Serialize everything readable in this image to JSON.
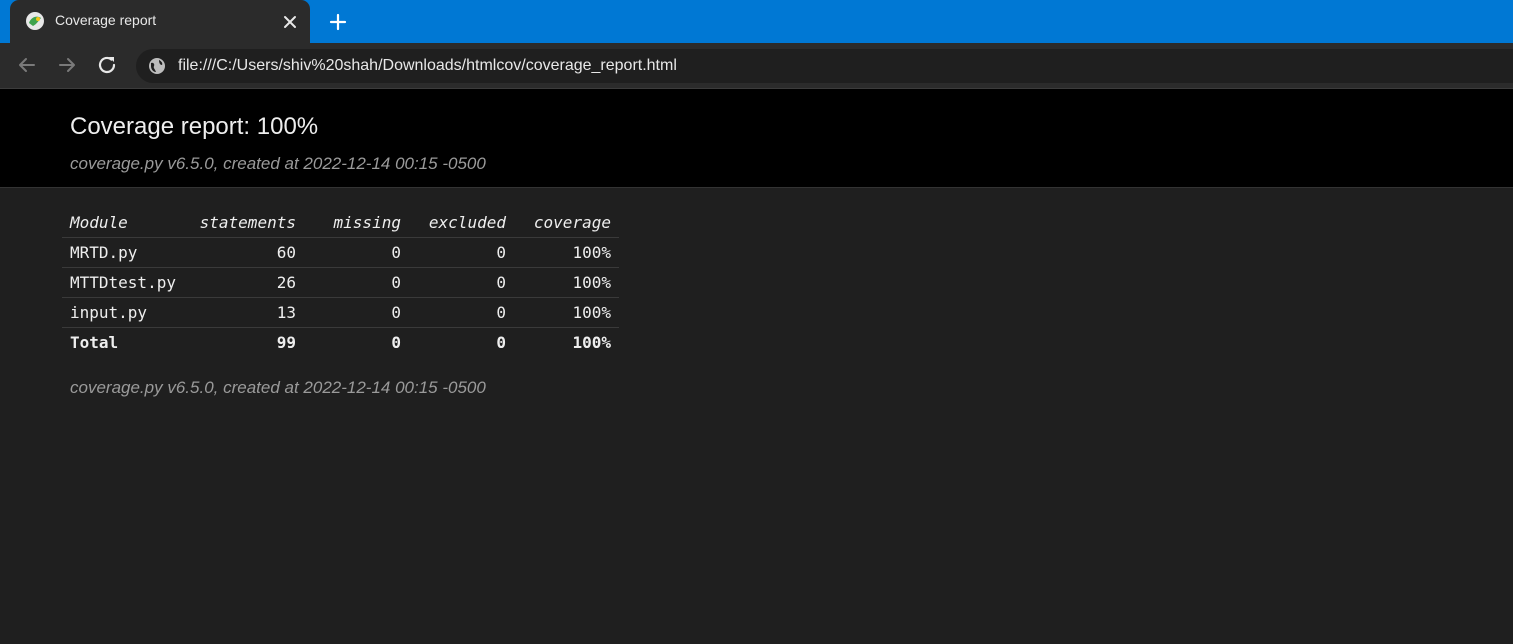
{
  "browser": {
    "tab_title": "Coverage report",
    "url": "file:///C:/Users/shiv%20shah/Downloads/htmlcov/coverage_report.html",
    "favicon": "coverage-favicon-icon",
    "accent_color": "#0078d4"
  },
  "header": {
    "title": "Coverage report: 100%",
    "meta": "coverage.py v6.5.0, created at 2022-12-14 00:15 -0500"
  },
  "table": {
    "columns": [
      "Module",
      "statements",
      "missing",
      "excluded",
      "coverage"
    ],
    "rows": [
      {
        "module": "MRTD.py",
        "statements": "60",
        "missing": "0",
        "excluded": "0",
        "coverage": "100%"
      },
      {
        "module": "MTTDtest.py",
        "statements": "26",
        "missing": "0",
        "excluded": "0",
        "coverage": "100%"
      },
      {
        "module": "input.py",
        "statements": "13",
        "missing": "0",
        "excluded": "0",
        "coverage": "100%"
      }
    ],
    "total": {
      "module": "Total",
      "statements": "99",
      "missing": "0",
      "excluded": "0",
      "coverage": "100%"
    }
  },
  "footer": {
    "meta": "coverage.py v6.5.0, created at 2022-12-14 00:15 -0500"
  }
}
